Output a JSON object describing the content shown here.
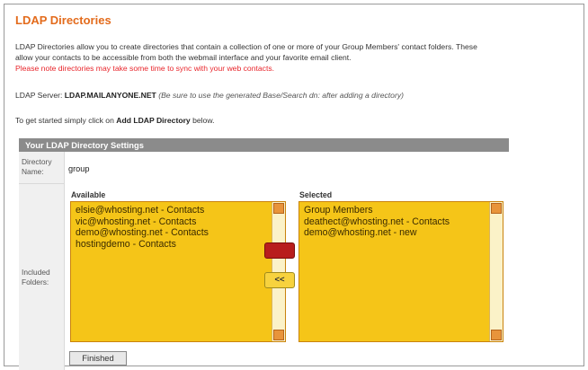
{
  "page": {
    "title": "LDAP Directories",
    "intro_line1": "LDAP Directories allow you to create directories that contain a collection of one or more of your Group Members' contact folders. These",
    "intro_line2": "allow your contacts to be accessible from both the webmail interface and your favorite email client.",
    "warning": "Please note directories may take some time to sync with your web contacts.",
    "server_label": "LDAP Server:",
    "server_value": "LDAP.MAILANYONE.NET",
    "server_note": "(Be sure to use the generated Base/Search dn: after adding a directory)",
    "start_prefix": "To get started simply click on",
    "start_link": "Add LDAP Directory",
    "start_suffix": "below."
  },
  "settings": {
    "header": "Your LDAP Directory Settings",
    "directory_name_label_1": "Directory",
    "directory_name_label_2": "Name:",
    "directory_name_value": "group",
    "included_label_1": "Included",
    "included_label_2": "Folders:",
    "available_label": "Available",
    "selected_label": "Selected",
    "available_items": [
      "elsie@whosting.net - Contacts",
      "vic@whosting.net - Contacts",
      "demo@whosting.net - Contacts",
      "hostingdemo - Contacts"
    ],
    "selected_items": [
      "Group Members",
      "deathect@whosting.net - Contacts",
      "demo@whosting.net - new"
    ],
    "move_left_label": "<<",
    "finished_label": "Finished"
  },
  "colors": {
    "title": "#e36b1c",
    "warning": "#e8252b",
    "list_bg": "#f5c518",
    "header_bg": "#8b8b8b"
  },
  "icons": {
    "scroll_up": "scroll-up-arrow-icon",
    "scroll_down": "scroll-down-arrow-icon"
  }
}
